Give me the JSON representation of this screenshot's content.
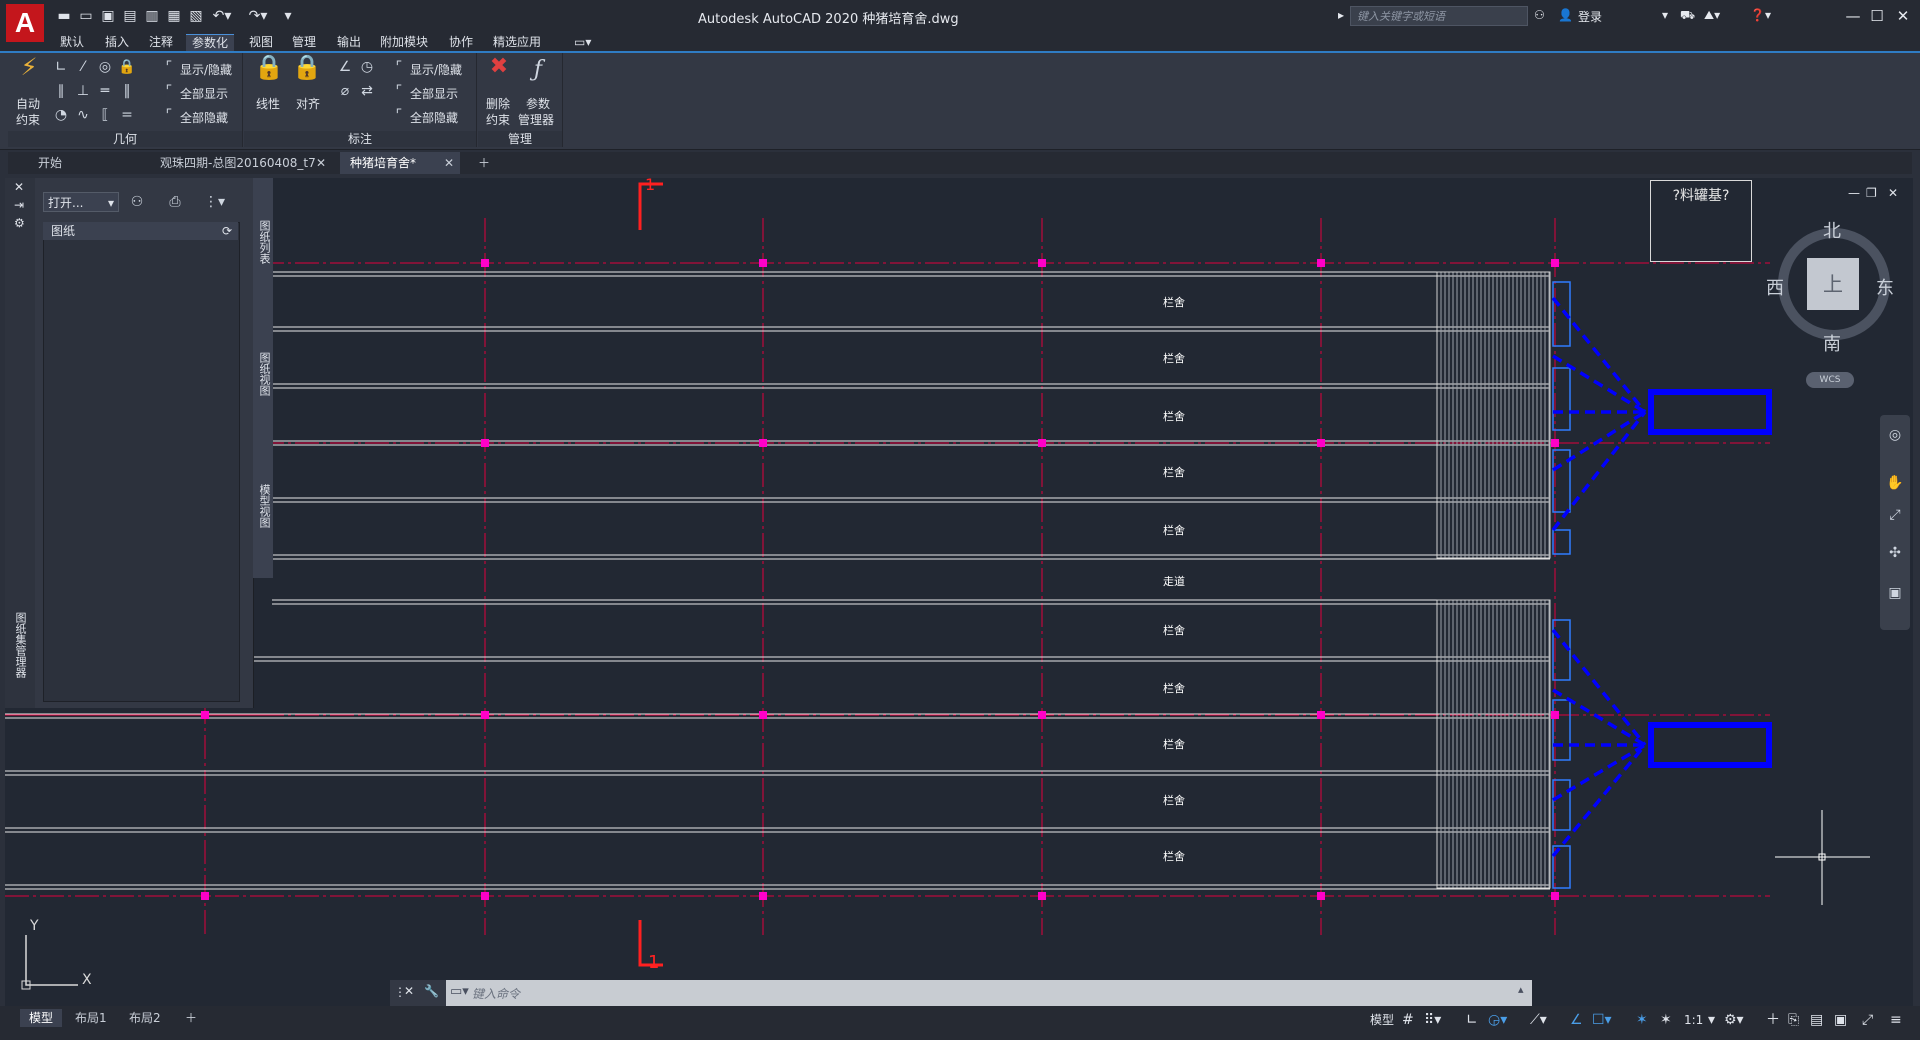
{
  "app": {
    "logo": "A",
    "title": "Autodesk AutoCAD 2020    种猪培育舍.dwg",
    "search_placeholder": "键入关键字或短语",
    "login": "登录"
  },
  "ribbon_tabs": [
    "默认",
    "插入",
    "注释",
    "参数化",
    "视图",
    "管理",
    "输出",
    "附加模块",
    "协作",
    "精选应用"
  ],
  "active_ribbon_tab": "参数化",
  "ribbon": {
    "geometry": {
      "auto_constrain_1": "自动",
      "auto_constrain_2": "约束",
      "show_hide": "显示/隐藏",
      "show_all": "全部显示",
      "hide_all": "全部隐藏",
      "title": "几何"
    },
    "dimension": {
      "linear": "线性",
      "aligned": "对齐",
      "show_hide": "显示/隐藏",
      "show_all": "全部显示",
      "hide_all": "全部隐藏",
      "title": "标注"
    },
    "manage": {
      "delete_1": "删除",
      "delete_2": "约束",
      "param_1": "参数",
      "param_2": "管理器",
      "title": "管理"
    }
  },
  "doc_tabs": [
    {
      "label": "开始"
    },
    {
      "label": "观珠四期-总图20160408_t7"
    },
    {
      "label": "种猪培育舍*"
    }
  ],
  "sheet_manager": {
    "open_label": "打开...",
    "list_header": "图纸",
    "vtab_list": "图纸列表",
    "vtab_views": "图纸视图",
    "vtab_model": "模型视图",
    "vtab_title": "图纸集管理器"
  },
  "drawing": {
    "section_mark": "1",
    "legend": "?料罐基?",
    "pen_label": "栏舍",
    "aisle_label": "走道",
    "axis_y": "Y",
    "axis_x": "X"
  },
  "viewcube": {
    "north": "北",
    "south": "南",
    "east": "东",
    "west": "西",
    "top": "上",
    "wcs": "WCS"
  },
  "command": {
    "placeholder": "键入命令"
  },
  "layout_tabs": [
    "模型",
    "布局1",
    "布局2"
  ],
  "status": {
    "model": "模型",
    "scale": "1:1"
  },
  "colors": {
    "accent": "#2f7cc4",
    "axis_red": "#e0003c",
    "node_magenta": "#ff00c8",
    "feeder_blue": "#0000ff"
  }
}
